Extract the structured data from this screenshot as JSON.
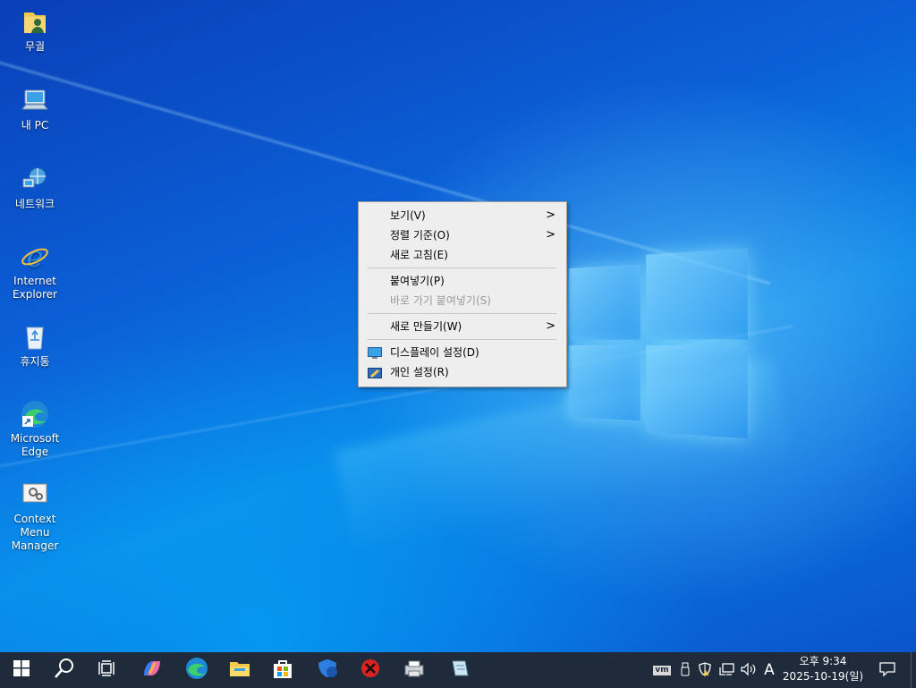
{
  "desktop_icons": [
    {
      "label": "무궐",
      "icon": "user-folder-icon"
    },
    {
      "label": "내 PC",
      "icon": "computer-icon"
    },
    {
      "label": "네트워크",
      "icon": "network-icon"
    },
    {
      "label": "Internet Explorer",
      "icon": "internet-explorer-icon"
    },
    {
      "label": "휴지통",
      "icon": "recycle-bin-icon"
    },
    {
      "label": "Microsoft Edge",
      "icon": "edge-shortcut-icon"
    },
    {
      "label": "Context Menu Manager",
      "icon": "context-menu-manager-icon"
    }
  ],
  "context_menu": {
    "items": [
      {
        "label": "보기(V)",
        "submenu": true
      },
      {
        "label": "정렬 기준(O)",
        "submenu": true
      },
      {
        "label": "새로 고침(E)"
      },
      {
        "label": "붙여넣기(P)"
      },
      {
        "label": "바로 가기 붙여넣기(S)",
        "disabled": true
      },
      {
        "label": "새로 만들기(W)",
        "submenu": true
      },
      {
        "label": "디스플레이 설정(D)",
        "icon": "display-settings-icon"
      },
      {
        "label": "개인 설정(R)",
        "icon": "personalize-icon"
      }
    ],
    "submenu_arrow": ">"
  },
  "taskbar": {
    "apps": [
      "start-icon",
      "search-icon",
      "task-view-icon",
      "copilot-icon",
      "edge-icon",
      "file-explorer-icon",
      "store-icon",
      "defender-icon",
      "close-red-icon",
      "printer-tool-icon",
      "notepad-tool-icon"
    ],
    "tray": {
      "vm_label": "vm",
      "ime": "A",
      "time": "오후 9:34",
      "date": "2025-10-19(일)"
    }
  },
  "colors": {
    "taskbar": "#1f2b3a",
    "menu_bg": "#eeeeee",
    "disabled_text": "#9a9a9a"
  }
}
